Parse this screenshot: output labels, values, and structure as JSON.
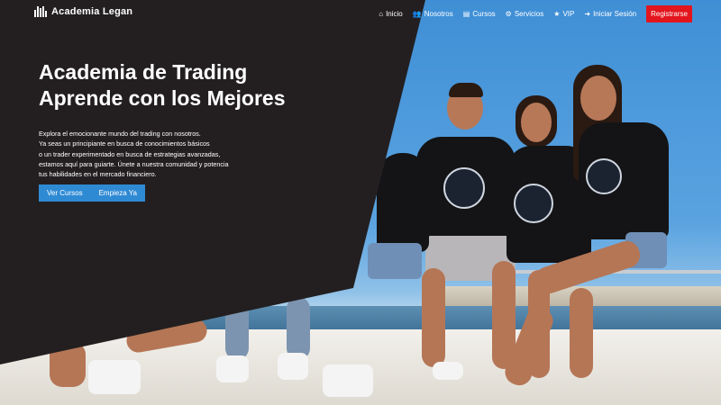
{
  "brand": {
    "name": "Academia Legan",
    "icon": "bars-logo-icon"
  },
  "nav": {
    "items": [
      {
        "label": "Inicio",
        "icon": "home-icon"
      },
      {
        "label": "Nosotros",
        "icon": "users-icon"
      },
      {
        "label": "Cursos",
        "icon": "book-icon"
      },
      {
        "label": "Servicios",
        "icon": "gears-icon"
      },
      {
        "label": "VIP",
        "icon": "star-icon"
      },
      {
        "label": "Iniciar Sesión",
        "icon": "sign-in-icon"
      }
    ],
    "register": "Registrarse"
  },
  "hero": {
    "title_line1": "Academia de Trading",
    "title_line2": "Aprende con los Mejores",
    "desc": [
      "Explora el emocionante mundo del trading con nosotros.",
      "Ya seas un principiante en busca de conocimientos básicos",
      "o un trader experimentado en busca de estrategias avanzadas,",
      "estamos aquí para guiarte. Únete a nuestra comunidad y potencia",
      "tus habilidades en el mercado financiero."
    ],
    "cta_primary": "Ver Cursos",
    "cta_secondary": "Empieza Ya"
  },
  "colors": {
    "panel": "#231f20",
    "accent": "#2f8ad4",
    "register": "#e3151d"
  }
}
